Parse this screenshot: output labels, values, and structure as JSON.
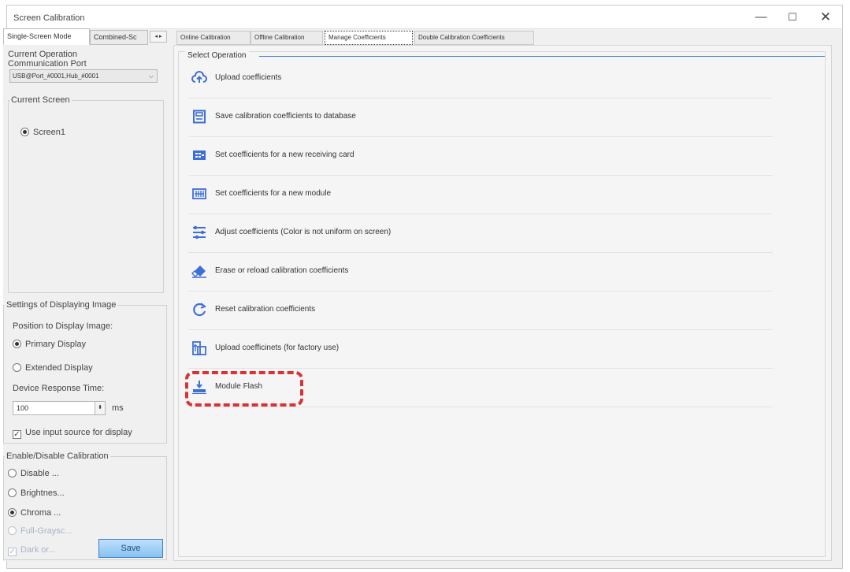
{
  "window": {
    "title": "Screen Calibration",
    "min": "—",
    "max": "☐",
    "close": "✕"
  },
  "left_tabs": {
    "tab1": "Single-Screen Mode",
    "tab2": "Combined-Sc",
    "arrows": "◂ ▸"
  },
  "current_operation": {
    "title": "Current Operation",
    "port_label": "Communication Port",
    "port_value": "USB@Port_#0001,Hub_#0001",
    "port_arrow": "⌵"
  },
  "current_screen": {
    "title": "Current Screen",
    "screen_label": "Screen1"
  },
  "display_settings": {
    "title": "Settings of Displaying Image",
    "position_label": "Position to Display Image:",
    "primary": "Primary Display",
    "extended": "Extended Display",
    "response_label": "Device Response Time:",
    "response_value": "100",
    "spin_icon": "⬍",
    "unit": "ms",
    "use_input_label": "Use input source for display",
    "check_mark": "✓"
  },
  "calibration": {
    "title": "Enable/Disable Calibration",
    "disable": "Disable ...",
    "brightness": "Brightnes...",
    "chroma": "Chroma ...",
    "full_gray": "Full-Graysc...",
    "dark": "Dark or...",
    "save": "Save"
  },
  "right_tabs": {
    "online": "Online Calibration",
    "offline": "Offline Calibration",
    "manage": "Manage Coefficients",
    "double": "Double Calibration Coefficients"
  },
  "operations": {
    "legend": "Select Operation",
    "items": [
      {
        "label": "Upload coefficients",
        "icon": "upload-cloud-icon"
      },
      {
        "label": "Save calibration coefficients to database",
        "icon": "save-icon"
      },
      {
        "label": "Set coefficients for a new receiving card",
        "icon": "receiving-card-icon"
      },
      {
        "label": "Set coefficients for a new module",
        "icon": "module-icon"
      },
      {
        "label": "Adjust coefficients (Color is not uniform on screen)",
        "icon": "sliders-icon"
      },
      {
        "label": "Erase or reload calibration coefficients",
        "icon": "eraser-icon"
      },
      {
        "label": "Reset calibration coefficients",
        "icon": "reset-icon"
      },
      {
        "label": "Upload coefficinets (for factory use)",
        "icon": "factory-upload-icon"
      },
      {
        "label": "Module Flash",
        "icon": "module-flash-icon"
      }
    ]
  },
  "colors": {
    "accent": "#3f6fd6",
    "highlight": "#d63535",
    "save_button": "#87c2f1"
  }
}
